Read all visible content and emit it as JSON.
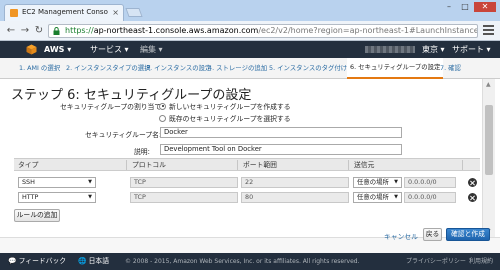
{
  "browser": {
    "tab_title": "EC2 Management Conso",
    "url_scheme": "https://",
    "url_host": "ap-northeast-1.console.aws.amazon.com",
    "url_path": "/ec2/v2/home?region=ap-northeast-1#LaunchInstance"
  },
  "aws_bar": {
    "brand": "AWS",
    "services": "サービス",
    "edit": "編集",
    "region": "東京",
    "support": "サポート"
  },
  "wizard": {
    "steps": [
      "1. AMI の選択",
      "2. インスタンスタイプの選択",
      "3. インスタンスの設定",
      "4. ストレージの追加",
      "5. インスタンスのタグ付け",
      "6. セキュリティグループの設定",
      "7. 確認"
    ],
    "active_index": 5
  },
  "page": {
    "title": "ステップ 6: セキュリティグループの設定",
    "assign_label": "セキュリティグループの割り当て:",
    "radio_new": "新しいセキュリティグループを作成する",
    "radio_existing": "既存のセキュリティグループを選択する",
    "sg_name_label": "セキュリティグループ名:",
    "sg_name_value": "Docker",
    "description_label": "説明:",
    "description_value": "Development Tool on Docker"
  },
  "rules_table": {
    "headers": [
      "タイプ",
      "プロトコル",
      "ポート範囲",
      "送信元"
    ],
    "rows": [
      {
        "type": "SSH",
        "protocol": "TCP",
        "port": "22",
        "source_mode": "任意の場所",
        "source_cidr": "0.0.0.0/0"
      },
      {
        "type": "HTTP",
        "protocol": "TCP",
        "port": "80",
        "source_mode": "任意の場所",
        "source_cidr": "0.0.0.0/0"
      }
    ],
    "add_rule_label": "ルールの追加"
  },
  "actions": {
    "cancel": "キャンセル",
    "back": "戻る",
    "review_and_launch": "確認と作成"
  },
  "footer": {
    "feedback": "フィードバック",
    "language": "日本語",
    "copyright": "© 2008 - 2015, Amazon Web Services, Inc. or its affiliates. All rights reserved.",
    "privacy": "プライバシーポリシー",
    "terms": "利用規約"
  },
  "colors": {
    "aws_bar": "#232f3e",
    "accent_orange": "#e47911",
    "link_blue": "#2b6ca3",
    "primary_button": "#1e63ad"
  }
}
